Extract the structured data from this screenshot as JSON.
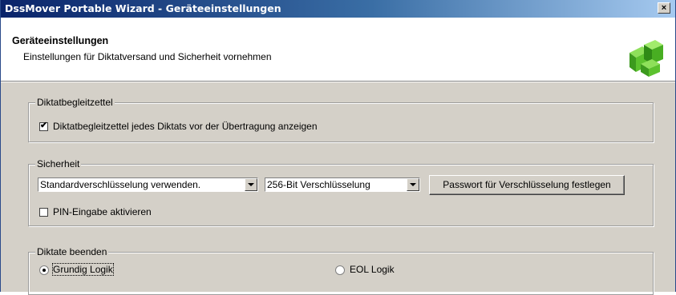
{
  "window": {
    "title": "DssMover Portable Wizard - Geräteeinstellungen",
    "close_label": "×"
  },
  "header": {
    "title": "Geräteeinstellungen",
    "subtitle": "Einstellungen für Diktatversand und Sicherheit vornehmen"
  },
  "groups": {
    "slip": {
      "legend": "Diktatbegleitzettel",
      "checkbox_label": "Diktatbegleitzettel jedes Diktats vor der Übertragung anzeigen",
      "checked": true
    },
    "security": {
      "legend": "Sicherheit",
      "encryption_mode": "Standardverschlüsselung verwenden.",
      "encryption_strength": "256-Bit Verschlüsselung",
      "password_button": "Passwort für Verschlüsselung festlegen",
      "pin_label": "PIN-Eingabe aktivieren",
      "pin_checked": false
    },
    "finish": {
      "legend": "Diktate beenden",
      "options": [
        "Grundig Logik",
        "EOL Logik"
      ],
      "selected": "Grundig Logik"
    }
  },
  "icons": {
    "logo": "green-cubes-logo-icon",
    "close": "close-icon",
    "checkmark": "✔"
  },
  "colors": {
    "titlebar_start": "#0a246a",
    "titlebar_end": "#a6caf0",
    "dialog_face": "#d4d0c8",
    "logo_green": "#4caf2a"
  }
}
